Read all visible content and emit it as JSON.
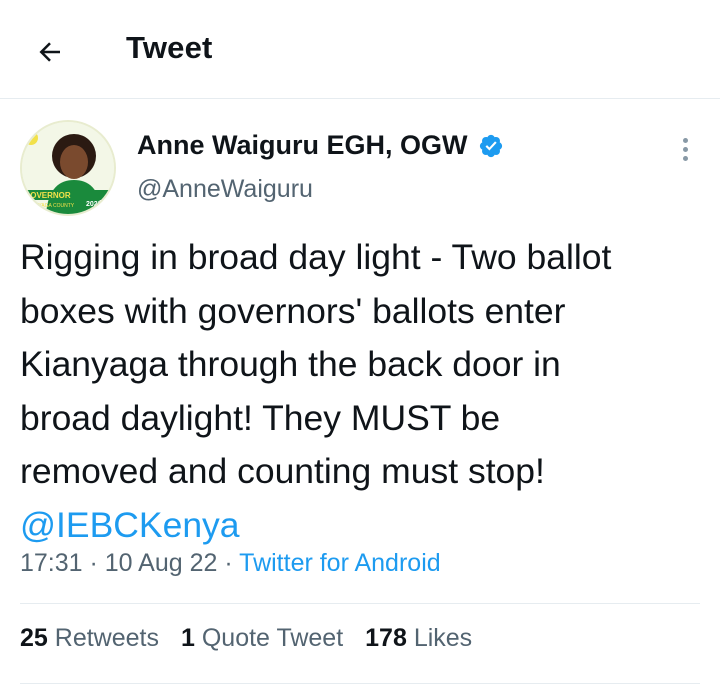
{
  "header": {
    "back_icon": "arrow-left-icon",
    "title": "Tweet"
  },
  "author": {
    "display_name": "Anne Waiguru EGH, OGW",
    "handle": "@AnneWaiguru",
    "verified_icon": "verified-badge-icon",
    "avatar": {
      "party_text": "UDA",
      "banner_text": "GOVERNOR",
      "year_text": "2022",
      "county_text": "KIRINYAGA COUNTY"
    }
  },
  "menu_icon": "more-vertical-icon",
  "tweet": {
    "lines": [
      "Rigging in broad day light - Two ballot",
      "boxes with governors' ballots enter",
      "Kianyaga through the back door in",
      "broad daylight! They MUST be",
      "removed and counting must stop!"
    ],
    "mention": "@IEBCKenya"
  },
  "meta": {
    "time": "17:31",
    "sep1": " · ",
    "date": "10 Aug 22",
    "sep2": " · ",
    "source": "Twitter for Android"
  },
  "stats": {
    "retweets_count": "25",
    "retweets_label": "Retweets",
    "quotes_count": "1",
    "quotes_label": "Quote Tweet",
    "likes_count": "178",
    "likes_label": "Likes"
  },
  "colors": {
    "accent": "#1d9bf0",
    "text": "#0f1419",
    "secondary": "#536471",
    "divider": "#e6ecf0",
    "avatar_green": "#1a8a3c",
    "avatar_yellow": "#f2e14a"
  }
}
